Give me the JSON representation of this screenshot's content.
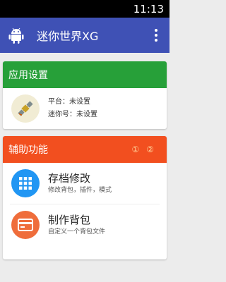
{
  "status_bar": {
    "time": "11:13"
  },
  "app_bar": {
    "title": "迷你世界XG",
    "icon": "android-icon",
    "menu_icon": "more-vert-icon"
  },
  "app_settings": {
    "header": "应用设置",
    "platform_label": "平台：未设置",
    "account_label": "迷你号：未设置",
    "icon": "satellite-icon"
  },
  "assist": {
    "header": "辅助功能",
    "badges": [
      "①",
      "②"
    ],
    "items": [
      {
        "title": "存档修改",
        "subtitle": "修改背包，插件，模式",
        "icon": "grid-icon"
      },
      {
        "title": "制作背包",
        "subtitle": "自定义一个背包文件",
        "icon": "card-icon"
      }
    ]
  },
  "colors": {
    "app_bar": "#3f51b5",
    "green_header": "#27a039",
    "orange_header": "#f24f1f",
    "settings_icon_bg": "#f1ecd4",
    "grid_icon_bg": "#2196f3",
    "card_icon_bg": "#ef6d3b"
  }
}
